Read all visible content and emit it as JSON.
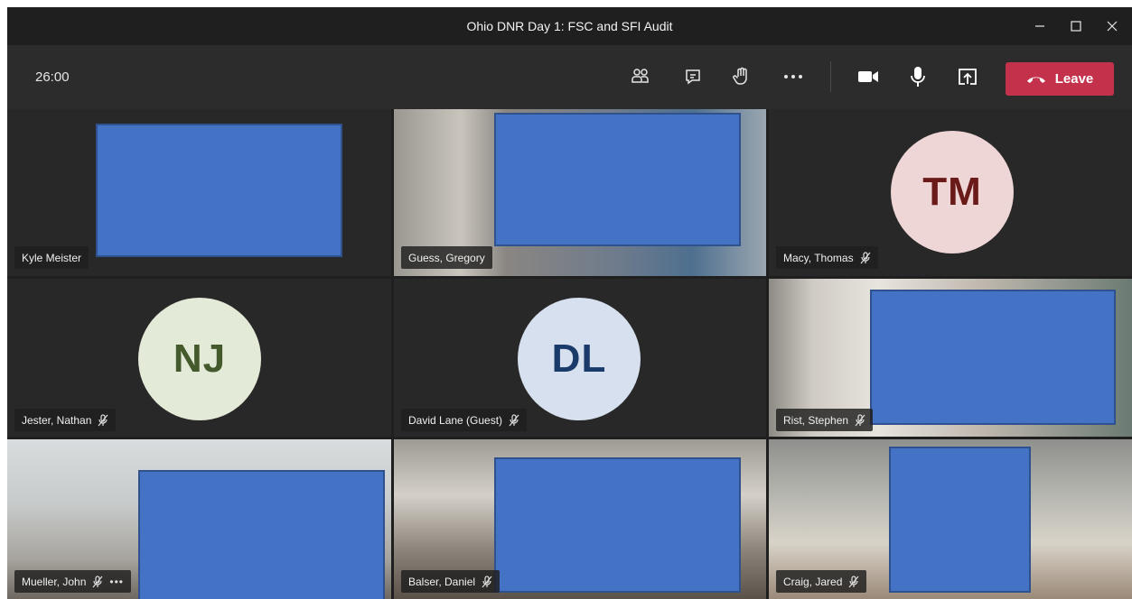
{
  "window": {
    "title": "Ohio DNR Day 1: FSC and SFI Audit"
  },
  "toolbar": {
    "timer": "26:00",
    "leave_label": "Leave",
    "buttons": [
      "participants-icon",
      "chat-icon",
      "raise-hand-icon",
      "more-options-icon",
      "camera-icon",
      "microphone-icon",
      "share-screen-icon"
    ]
  },
  "colors": {
    "leave": "#c4314b",
    "redaction": "#4472c4",
    "background": "#201f1f"
  },
  "participants": [
    {
      "name": "Kyle Meister",
      "muted": false,
      "video": true
    },
    {
      "name": "Guess, Gregory",
      "muted": false,
      "video": true
    },
    {
      "name": "Macy, Thomas",
      "muted": true,
      "initials": "TM"
    },
    {
      "name": "Jester, Nathan",
      "muted": true,
      "initials": "NJ"
    },
    {
      "name": "David Lane (Guest)",
      "muted": true,
      "initials": "DL"
    },
    {
      "name": "Rist, Stephen",
      "muted": true,
      "video": true
    },
    {
      "name": "Mueller, John",
      "muted": true,
      "video": true
    },
    {
      "name": "Balser, Daniel",
      "muted": true,
      "video": true
    },
    {
      "name": "Craig, Jared",
      "muted": true,
      "video": true
    }
  ]
}
